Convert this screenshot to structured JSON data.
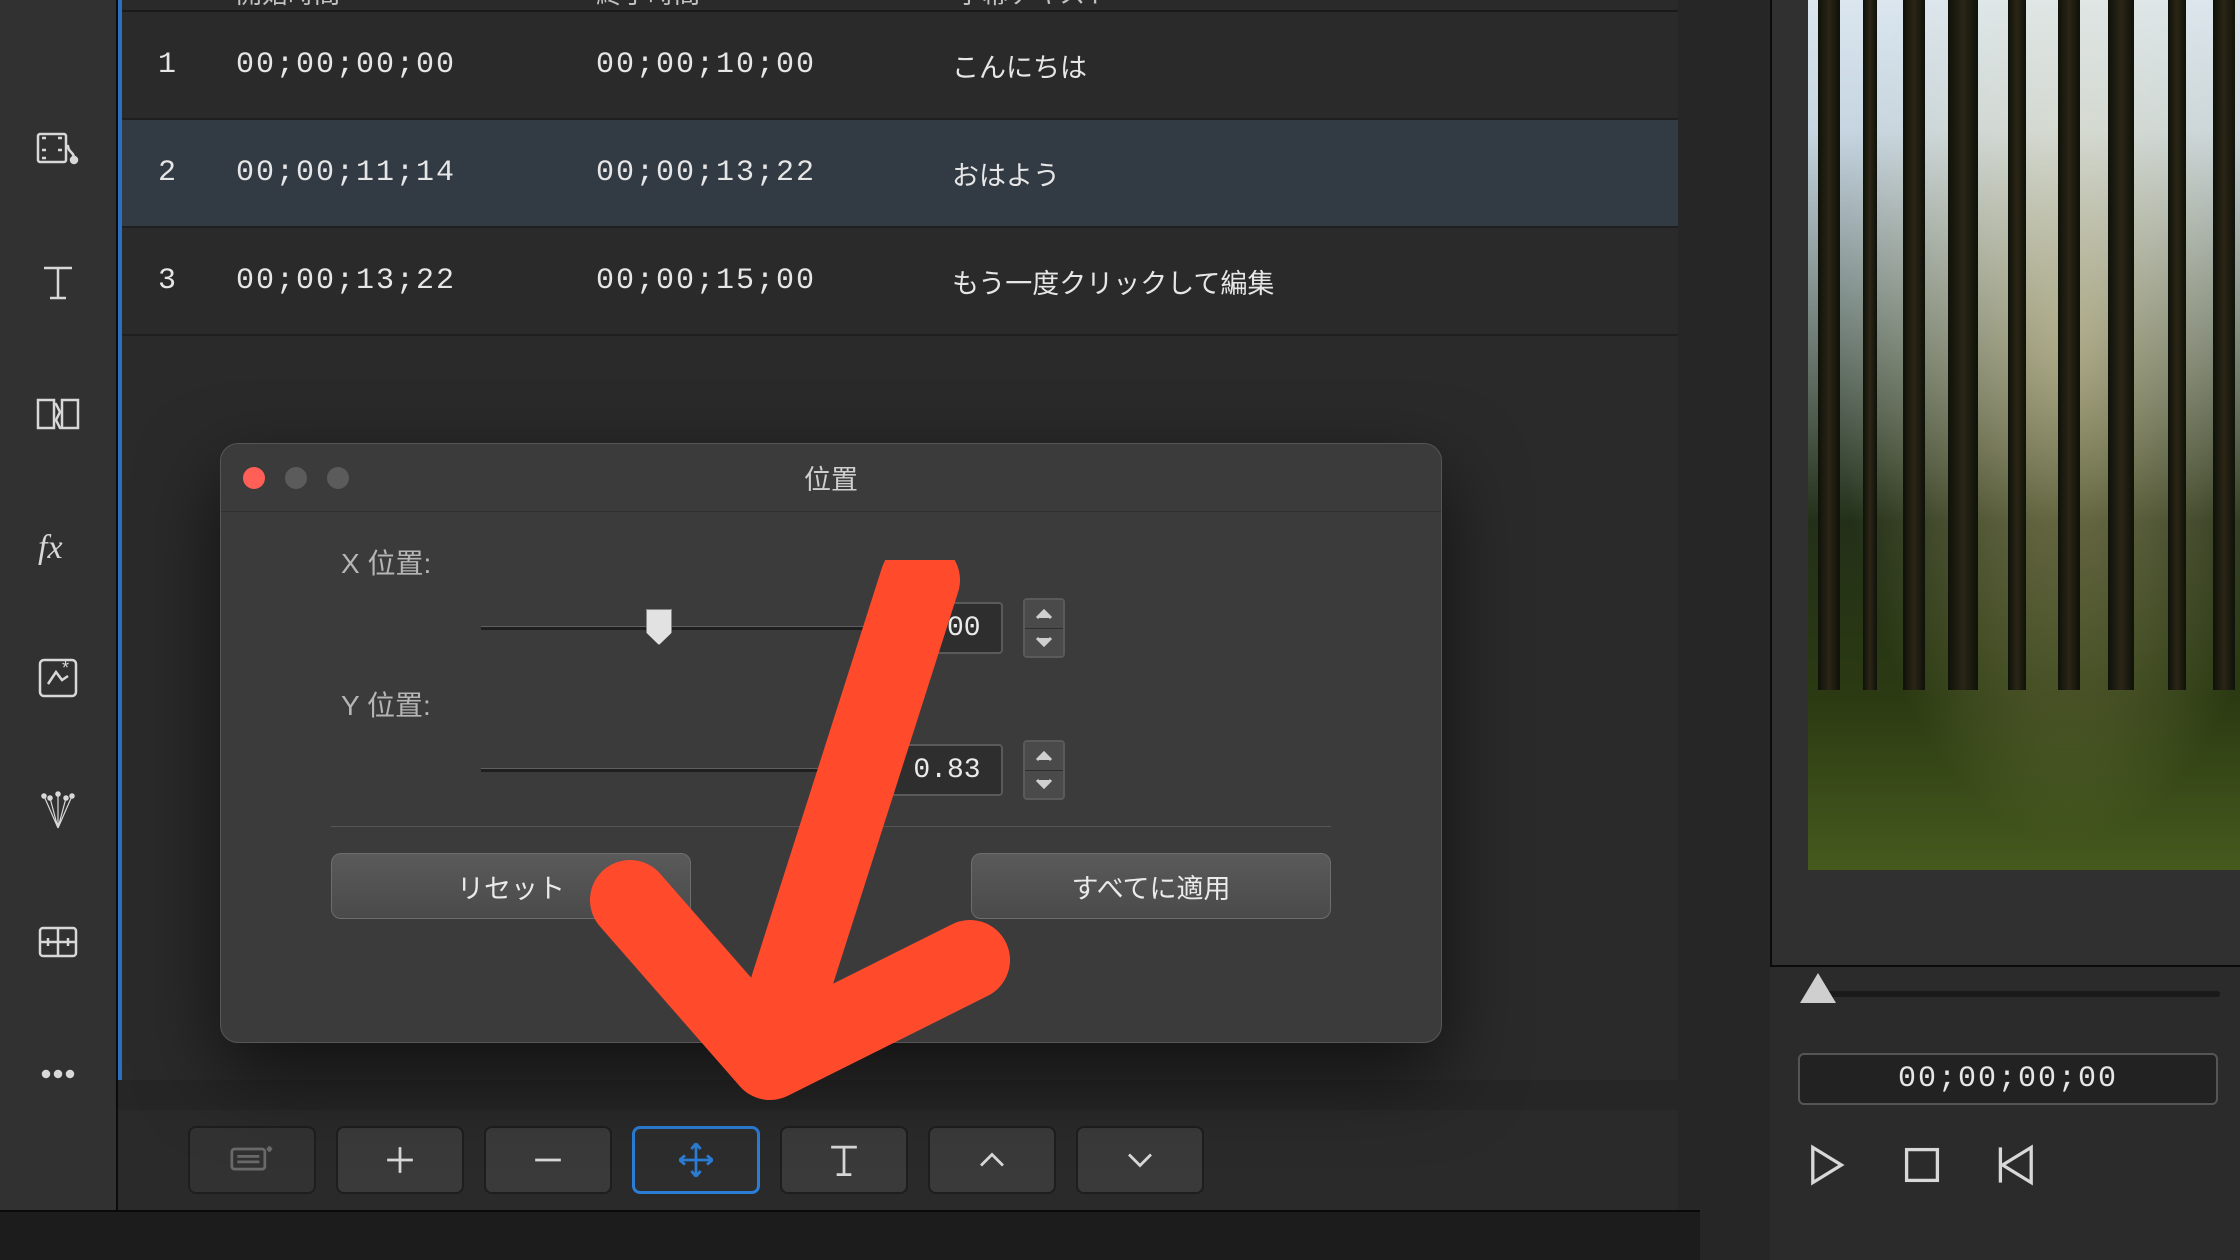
{
  "subtitle_table": {
    "headers": {
      "start": "開始時間",
      "end": "終了時間",
      "text": "字幕テキスト"
    },
    "rows": [
      {
        "idx": "1",
        "start": "00;00;00;00",
        "end": "00;00;10;00",
        "text": "こんにちは"
      },
      {
        "idx": "2",
        "start": "00;00;11;14",
        "end": "00;00;13;22",
        "text": "おはよう"
      },
      {
        "idx": "3",
        "start": "00;00;13;22",
        "end": "00;00;15;00",
        "text": "もう一度クリックして編集"
      }
    ]
  },
  "dialog": {
    "title": "位置",
    "x_label": "X 位置:",
    "y_label": "Y 位置:",
    "x_value": "0.00",
    "y_value": "0.83",
    "reset_label": "リセット",
    "apply_all_label": "すべてに適用"
  },
  "preview": {
    "timecode": "00;00;00;00"
  },
  "colors": {
    "arrow": "#ff4b2b",
    "accent": "#2b7dd6"
  }
}
